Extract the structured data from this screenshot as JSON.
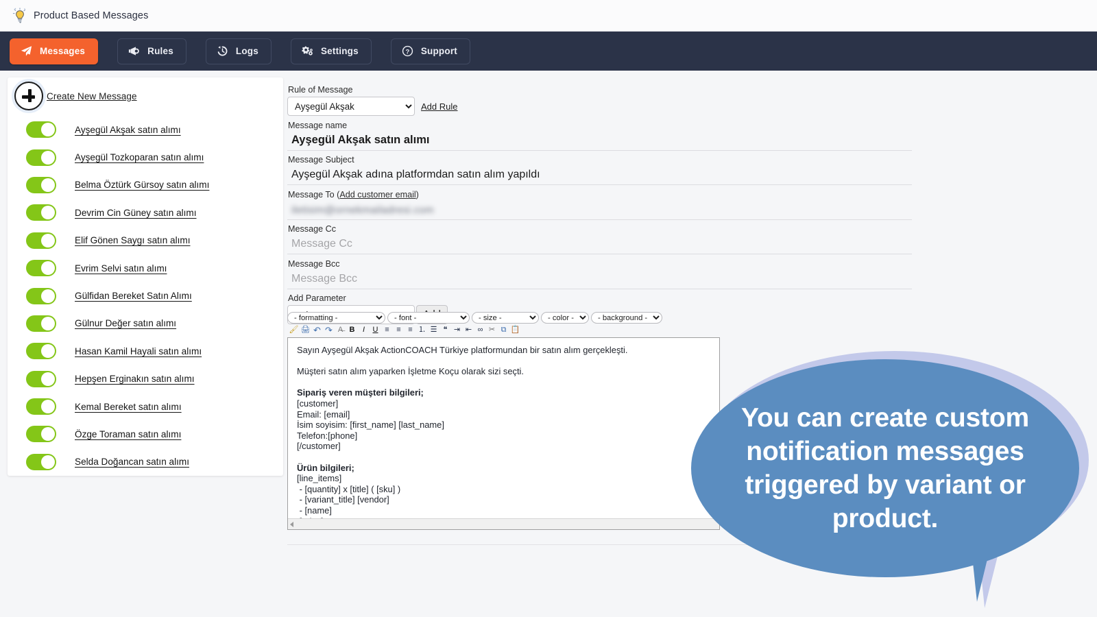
{
  "window": {
    "logo_icon": "lightbulb-icon",
    "title": "Product Based Messages"
  },
  "nav": {
    "items": [
      {
        "label": "Messages",
        "icon": "paper-plane-icon",
        "active": true
      },
      {
        "label": "Rules",
        "icon": "megaphone-icon",
        "active": false
      },
      {
        "label": "Logs",
        "icon": "history-clock-icon",
        "active": false
      },
      {
        "label": "Settings",
        "icon": "gears-icon",
        "active": false
      },
      {
        "label": "Support",
        "icon": "question-circle-icon",
        "active": false
      }
    ],
    "active_color": "#f4622d",
    "bar_color": "#2b3348"
  },
  "sidebar": {
    "create_label": "Create New Message",
    "create_icon": "plus-circle-icon",
    "toggle_color": "#84c618",
    "items": [
      {
        "label": "Ayşegül Akşak satın alımı",
        "enabled": true
      },
      {
        "label": "Ayşegül Tozkoparan satın alımı",
        "enabled": true
      },
      {
        "label": "Belma Öztürk Gürsoy satın alımı",
        "enabled": true
      },
      {
        "label": "Devrim Cin Güney satın alımı",
        "enabled": true
      },
      {
        "label": "Elif Gönen Saygı satın alımı",
        "enabled": true
      },
      {
        "label": "Evrim Selvi satın alımı",
        "enabled": true
      },
      {
        "label": "Gülfidan Bereket Satın Alımı",
        "enabled": true
      },
      {
        "label": "Gülnur Değer satın alımı",
        "enabled": true
      },
      {
        "label": "Hasan Kamil Hayali satın alımı",
        "enabled": true
      },
      {
        "label": "Hepşen Erginakın satın alımı",
        "enabled": true
      },
      {
        "label": "Kemal Bereket satın alımı",
        "enabled": true
      },
      {
        "label": "Özge Toraman satın alımı",
        "enabled": true
      },
      {
        "label": "Selda Doğancan satın alımı",
        "enabled": true
      }
    ]
  },
  "form": {
    "rule_of_message": {
      "label": "Rule of Message",
      "value": "Ayşegül Akşak",
      "add_rule_link": "Add Rule"
    },
    "message_name": {
      "label": "Message name",
      "value": "Ayşegül Akşak satın alımı"
    },
    "message_subject": {
      "label": "Message Subject",
      "value": "Ayşegül Akşak adına platformdan satın alım yapıldı"
    },
    "message_to": {
      "label": "Message To (",
      "link": "Add customer email",
      "label_close": ")",
      "value_redacted": "iletisim@ornekmailadresi.com"
    },
    "message_cc": {
      "label": "Message Cc",
      "value": "",
      "placeholder": "Message Cc"
    },
    "message_bcc": {
      "label": "Message Bcc",
      "value": "",
      "placeholder": "Message Bcc"
    },
    "add_parameter": {
      "label": "Add Parameter",
      "value": "order",
      "button": "Add"
    }
  },
  "editor": {
    "toolbar": {
      "selects": [
        "- formatting -",
        "- font -",
        "- size -",
        "- color -",
        "- background -"
      ],
      "buttons": [
        "clean-brush-icon",
        "print-icon",
        "undo-icon",
        "redo-icon",
        "remove-format-icon",
        "bold-icon",
        "italic-icon",
        "underline-icon",
        "align-left-icon",
        "align-center-icon",
        "align-right-icon",
        "ordered-list-icon",
        "unordered-list-icon",
        "blockquote-icon",
        "indent-icon",
        "outdent-icon",
        "link-icon",
        "cut-icon",
        "copy-icon",
        "paste-icon"
      ]
    },
    "content_lines": [
      {
        "text": "Sayın Ayşegül Akşak ActionCOACH Türkiye platformundan bir satın alım gerçekleşti.",
        "bold": false
      },
      {
        "text": "",
        "bold": false
      },
      {
        "text": "Müşteri satın alım yaparken İşletme Koçu olarak sizi seçti.",
        "bold": false
      },
      {
        "text": "",
        "bold": false
      },
      {
        "text": "Sipariş veren müşteri bilgileri;",
        "bold": true
      },
      {
        "text": "[customer]",
        "bold": false
      },
      {
        "text": "Email: [email]",
        "bold": false
      },
      {
        "text": "İsim soyisim: [first_name] [last_name]",
        "bold": false
      },
      {
        "text": "Telefon:[phone]",
        "bold": false
      },
      {
        "text": "[/customer]",
        "bold": false
      },
      {
        "text": "",
        "bold": false
      },
      {
        "text": "Ürün bilgileri;",
        "bold": true
      },
      {
        "text": "[line_items]",
        "bold": false
      },
      {
        "text": " - [quantity] x [title] ( [sku] )",
        "bold": false
      },
      {
        "text": " - [variant_title] [vendor]",
        "bold": false
      },
      {
        "text": " - [name]",
        "bold": false
      },
      {
        "text": " [price]",
        "bold": false
      }
    ]
  },
  "callout": {
    "text": "You can create custom notification messages triggered by variant or product.",
    "background": "#5b8dc0",
    "shadow": "#c3c9ea",
    "text_color": "#ffffff"
  }
}
